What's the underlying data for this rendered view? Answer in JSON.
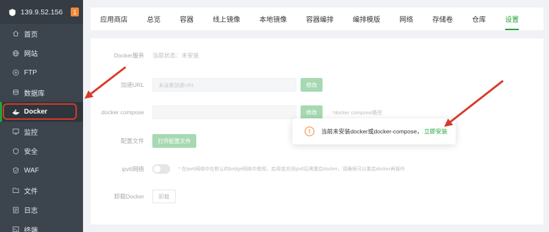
{
  "sidebar": {
    "server_ip": "139.9.52.156",
    "badge": "1",
    "items": [
      {
        "label": "首页",
        "icon": "home-icon"
      },
      {
        "label": "网站",
        "icon": "globe-icon"
      },
      {
        "label": "FTP",
        "icon": "ftp-icon"
      },
      {
        "label": "数据库",
        "icon": "database-icon"
      },
      {
        "label": "Docker",
        "icon": "docker-icon",
        "active": true
      },
      {
        "label": "监控",
        "icon": "monitor-icon"
      },
      {
        "label": "安全",
        "icon": "shield-icon"
      },
      {
        "label": "WAF",
        "icon": "waf-shield-icon"
      },
      {
        "label": "文件",
        "icon": "folder-icon"
      },
      {
        "label": "日志",
        "icon": "log-icon"
      },
      {
        "label": "终端",
        "icon": "terminal-icon"
      }
    ]
  },
  "tabs": [
    "应用商店",
    "总览",
    "容器",
    "线上镜像",
    "本地镜像",
    "容器编排",
    "编排模版",
    "网络",
    "存储卷",
    "仓库",
    "设置"
  ],
  "active_tab": "设置",
  "settings": {
    "service": {
      "label": "Docker服务",
      "status": "当前状态：未安装"
    },
    "mirror": {
      "label": "加速URL",
      "placeholder": "未设置加速URL",
      "button": "修改"
    },
    "compose": {
      "label": "docker compose",
      "placeholder": "",
      "button": "修改",
      "hint": "*docker compose路径"
    },
    "config": {
      "label": "配置文件",
      "button": "打开配置文件"
    },
    "ipv6": {
      "label": "ipv6网络",
      "enabled": false,
      "hint": "* 在ipv6网络中在默认的bridge网络中使用，启用或关闭ipv6后需重启docker，请确保可以重启docker再操作"
    },
    "uninstall": {
      "label": "卸载Docker",
      "button": "卸载"
    }
  },
  "popover": {
    "message": "当前未安装docker或docker-compose，",
    "link": "立即安装",
    "icon": "warning-icon"
  },
  "colors": {
    "sidebar_bg": "#3c444d",
    "accent": "#20a53a",
    "badge": "#f0893a",
    "annotation_red": "#d83a2a"
  }
}
